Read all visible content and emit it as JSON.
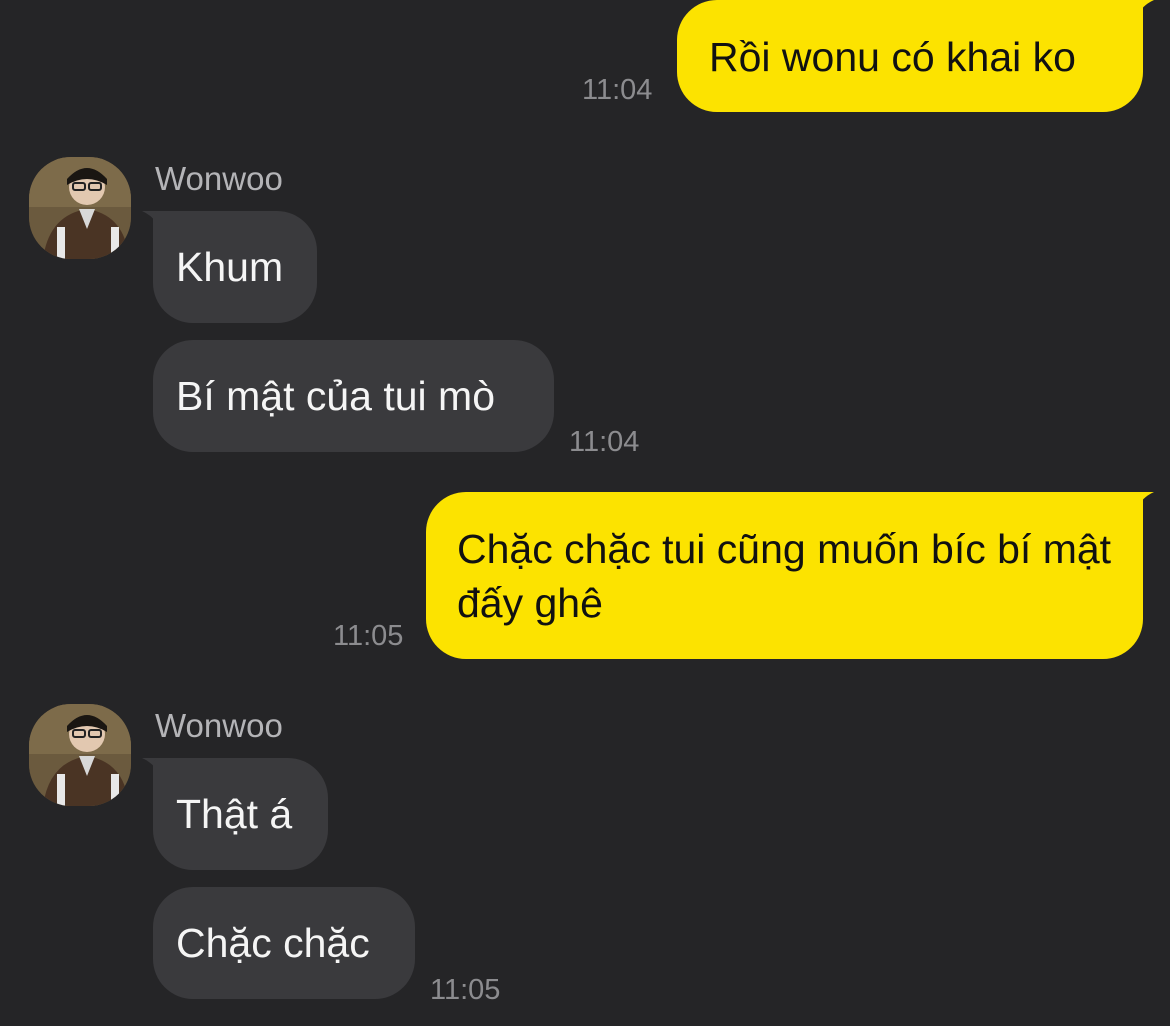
{
  "colors": {
    "background": "#252527",
    "outgoing_bubble": "#FCE300",
    "incoming_bubble": "#3A3A3D",
    "timestamp": "#8C8C8F",
    "sender_name": "#B4B4B7"
  },
  "messages": [
    {
      "direction": "outgoing",
      "text": "Rồi wonu có khai ko",
      "time": "11:04"
    },
    {
      "direction": "incoming",
      "sender": "Wonwoo",
      "avatar": "wonwoo-avatar",
      "texts": [
        "Khum",
        "Bí mật của tui mò"
      ],
      "time": "11:04"
    },
    {
      "direction": "outgoing",
      "text": "Chặc chặc tui cũng muốn bíc bí mật đấy ghê",
      "time": "11:05"
    },
    {
      "direction": "incoming",
      "sender": "Wonwoo",
      "avatar": "wonwoo-avatar",
      "texts": [
        "Thật á",
        "Chặc chặc"
      ],
      "time": "11:05"
    }
  ]
}
